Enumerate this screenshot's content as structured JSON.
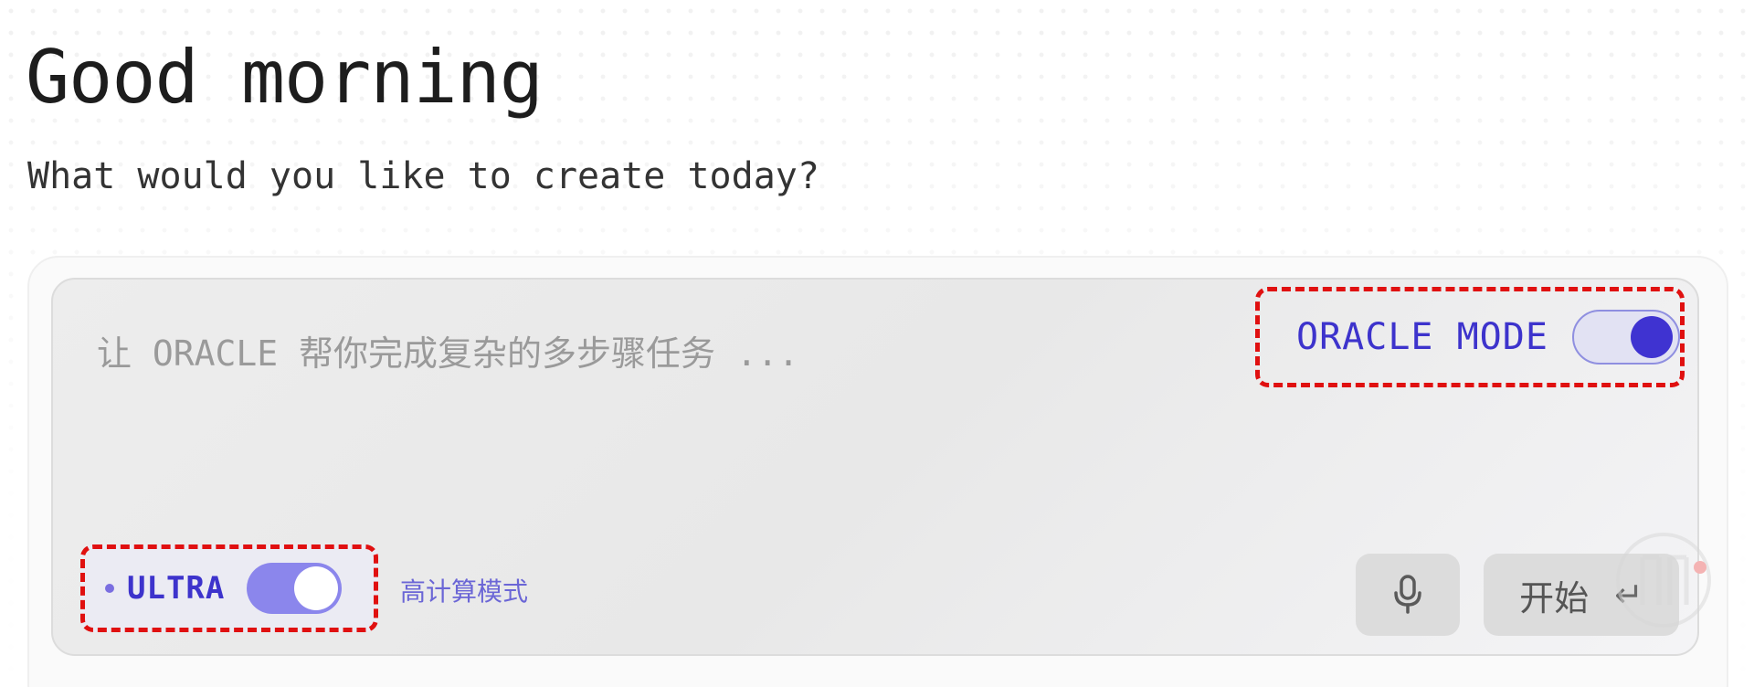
{
  "header": {
    "greeting": "Good morning",
    "subtitle": "What would you like to create today?"
  },
  "composer": {
    "placeholder": "让 ORACLE 帮你完成复杂的多步骤任务 ...",
    "oracle_mode": {
      "label": "ORACLE MODE",
      "enabled": true
    },
    "ultra": {
      "label": "ULTRA",
      "enabled": true,
      "description": "高计算模式"
    },
    "mic_icon": "microphone-icon",
    "start": {
      "label": "开始",
      "icon": "enter-icon",
      "glyph": "↵"
    }
  },
  "colors": {
    "accent": "#3d33cc",
    "toggle_track_on": "#8b86ec",
    "highlight_border": "#e01010"
  }
}
